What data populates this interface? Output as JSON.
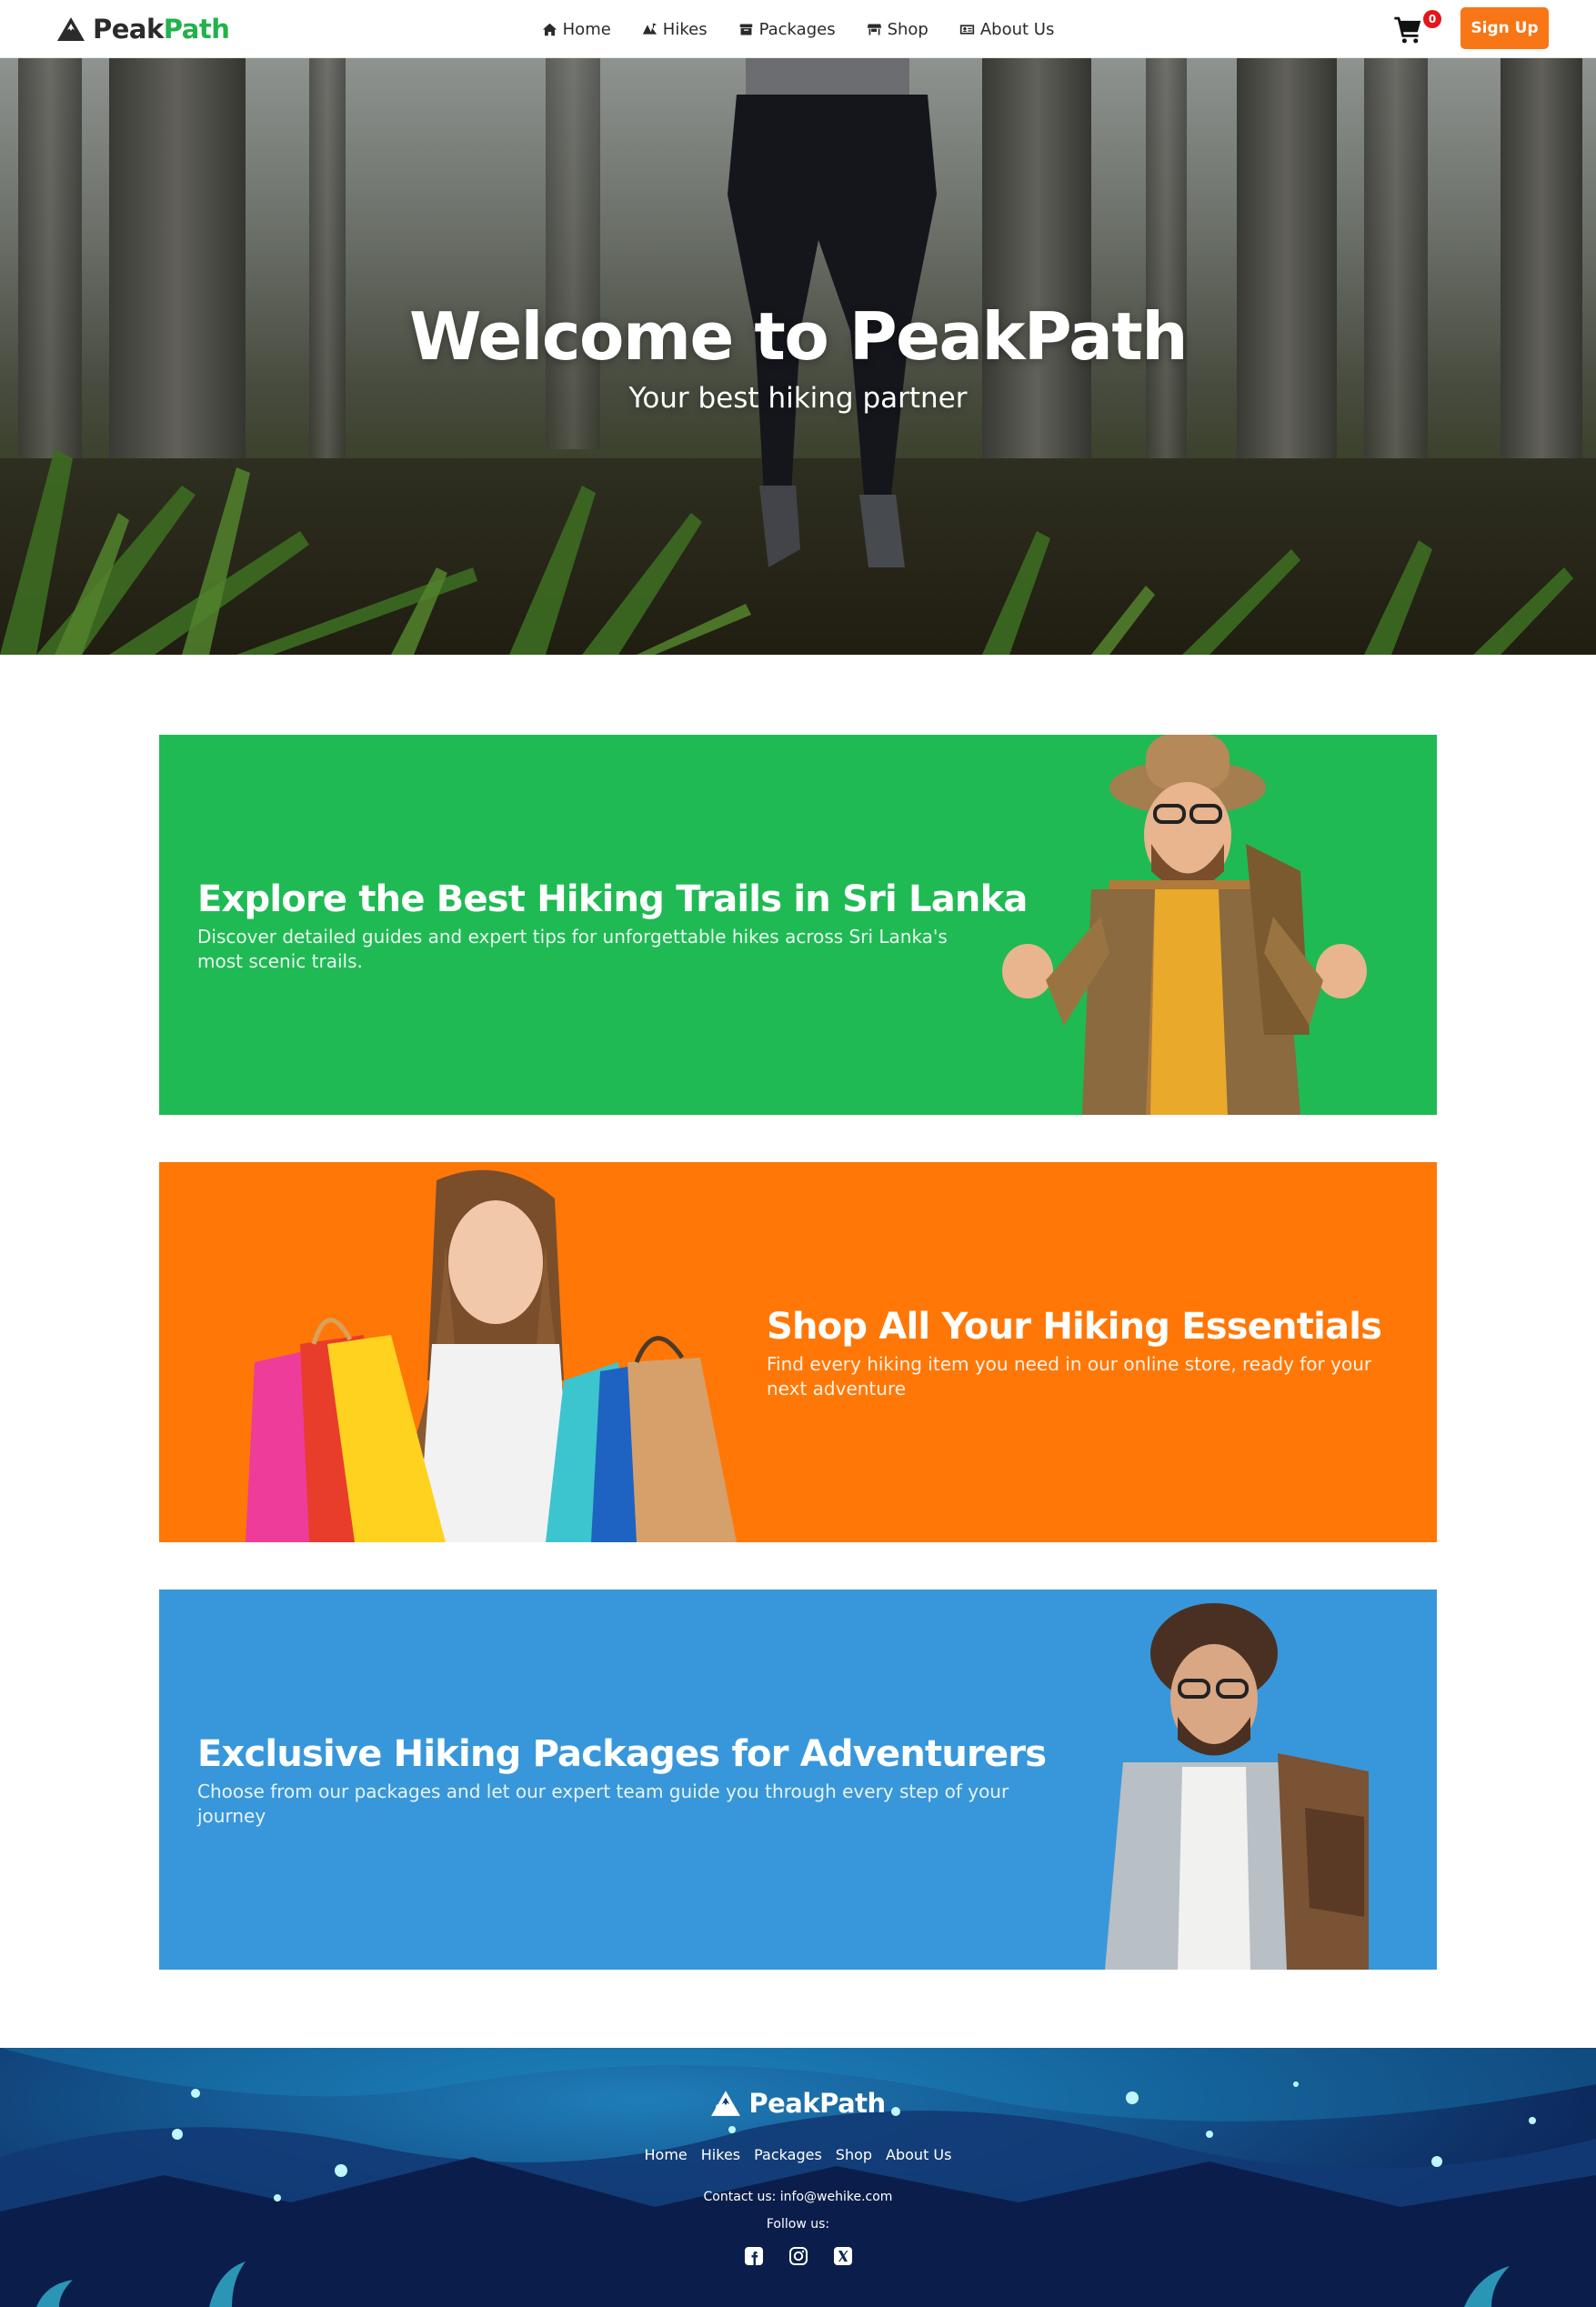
{
  "brand": {
    "part1": "Peak",
    "part2": "Path"
  },
  "nav": {
    "links": [
      {
        "label": "Home",
        "icon": "home-icon"
      },
      {
        "label": "Hikes",
        "icon": "mountain-icon"
      },
      {
        "label": "Packages",
        "icon": "box-icon"
      },
      {
        "label": "Shop",
        "icon": "store-icon"
      },
      {
        "label": "About Us",
        "icon": "id-card-icon"
      }
    ],
    "cart_count": "0",
    "signup_label": "Sign Up"
  },
  "hero": {
    "title": "Welcome to PeakPath",
    "subtitle": "Your best hiking partner"
  },
  "banners": [
    {
      "title": "Explore the Best Hiking Trails in Sri Lanka",
      "text": "Discover detailed guides and expert tips for unforgettable hikes across Sri Lanka's most scenic trails.",
      "color": "#1fba54"
    },
    {
      "title": "Shop All Your Hiking Essentials",
      "text": "Find every hiking item you need in our online store, ready for your next adventure",
      "color": "#ff7707"
    },
    {
      "title": "Exclusive Hiking Packages for Adventurers",
      "text": "Choose from our packages and let our expert team guide you through every step of your journey",
      "color": "#3897da"
    }
  ],
  "footer": {
    "brand": "PeakPath",
    "links": [
      "Home",
      "Hikes",
      "Packages",
      "Shop",
      "About Us"
    ],
    "contact": "Contact us: info@wehike.com",
    "follow": "Follow us:",
    "social": [
      "facebook-icon",
      "instagram-icon",
      "x-icon"
    ]
  },
  "colors": {
    "accent_green": "#22b24c",
    "signup_orange": "#f87615",
    "badge_red": "#e3161b"
  }
}
